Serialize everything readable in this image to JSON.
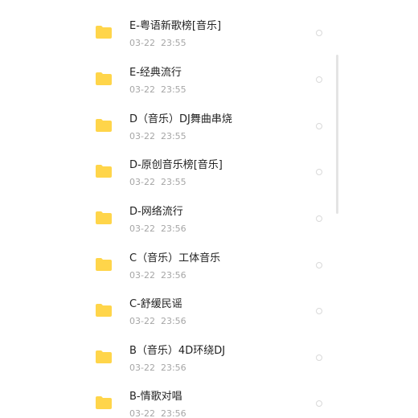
{
  "accent_color": "#FFD54A",
  "item_icon": "folder-icon",
  "files": [
    {
      "name": "E-粤语新歌榜[音乐]",
      "date": "03-22",
      "time": "23:55"
    },
    {
      "name": "E-经典流行",
      "date": "03-22",
      "time": "23:55"
    },
    {
      "name": "D（音乐）DJ舞曲串烧",
      "date": "03-22",
      "time": "23:55"
    },
    {
      "name": "D-原创音乐榜[音乐]",
      "date": "03-22",
      "time": "23:55"
    },
    {
      "name": "D-网络流行",
      "date": "03-22",
      "time": "23:56"
    },
    {
      "name": "C（音乐）工体音乐",
      "date": "03-22",
      "time": "23:56"
    },
    {
      "name": "C-舒缓民谣",
      "date": "03-22",
      "time": "23:56"
    },
    {
      "name": "B（音乐）4D环绕DJ",
      "date": "03-22",
      "time": "23:56"
    },
    {
      "name": "B-情歌对唱",
      "date": "03-22",
      "time": "23:56"
    }
  ]
}
